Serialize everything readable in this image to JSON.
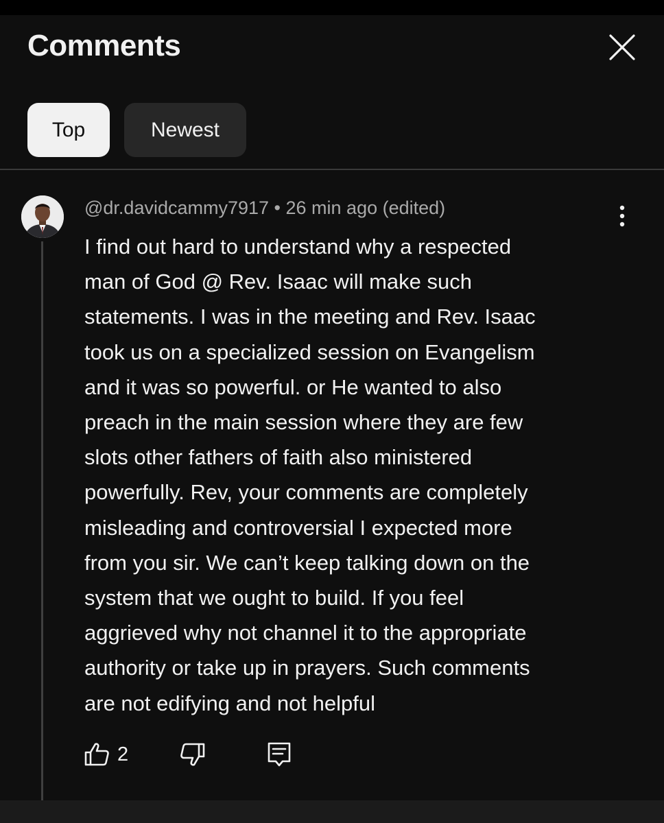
{
  "header": {
    "title": "Comments"
  },
  "sort_tabs": [
    {
      "label": "Top",
      "selected": true
    },
    {
      "label": "Newest",
      "selected": false
    }
  ],
  "comment": {
    "handle": "@dr.davidcammy7917",
    "separator": " • ",
    "timestamp": "26 min ago (edited)",
    "lines": [
      "I find out hard to understand why a respected",
      "man of God @ Rev. Isaac will make such",
      "statements. I was in the meeting and Rev. Isaac",
      "took us on a specialized session on Evangelism",
      "and it was so powerful. or He wanted to also",
      "preach in the main session where they are few",
      "slots other fathers of faith also ministered",
      "powerfully. Rev, your comments are completely",
      "misleading and controversial I expected more",
      "from you sir. We can’t keep talking down on the",
      "system that we ought to build. If you feel",
      "aggrieved why not channel it to the appropriate",
      "authority or take up in prayers. Such comments",
      "are not edifying and not helpful"
    ],
    "like_count": "2"
  },
  "icons": {
    "close": "close-icon",
    "more": "more-vertical-icon",
    "like": "thumbs-up-icon",
    "dislike": "thumbs-down-icon",
    "reply": "reply-comment-icon"
  },
  "colors": {
    "background": "#0f0f0f",
    "text_primary": "#f1f1f1",
    "text_secondary": "#aaaaaa",
    "chip_selected_bg": "#f1f1f1",
    "chip_bg": "#272727"
  }
}
